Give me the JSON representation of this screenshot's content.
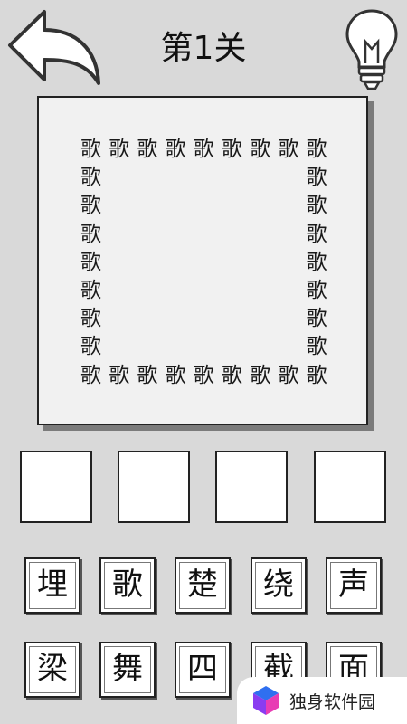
{
  "header": {
    "level_title": "第1关",
    "back_icon": "back-arrow-icon",
    "hint_icon": "lightbulb-icon"
  },
  "puzzle": {
    "char": "歌",
    "frame": "9x9 square outline of the character"
  },
  "answer_slots": [
    "",
    "",
    "",
    ""
  ],
  "choices": [
    {
      "char": "埋"
    },
    {
      "char": "歌"
    },
    {
      "char": "楚"
    },
    {
      "char": "绕"
    },
    {
      "char": "声"
    },
    {
      "char": "梁"
    },
    {
      "char": "舞"
    },
    {
      "char": "四"
    },
    {
      "char": "截"
    },
    {
      "char": "面"
    }
  ],
  "watermark": {
    "text": "独身软件园",
    "icon": "cube-logo-icon",
    "colors": {
      "blue": "#2f6ff0",
      "purple": "#8a3cf0",
      "pink": "#e83cb4"
    }
  }
}
